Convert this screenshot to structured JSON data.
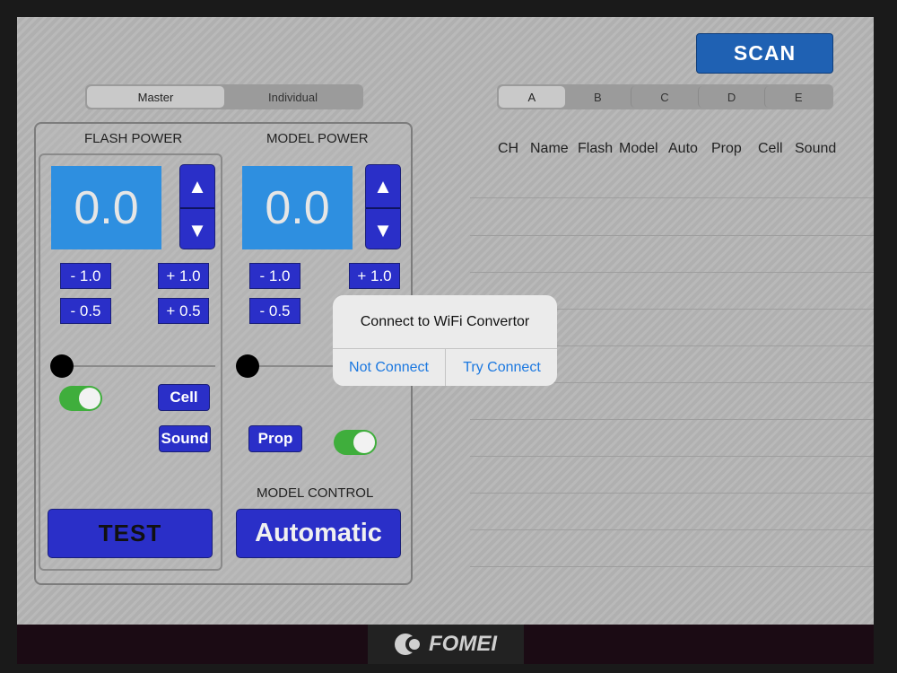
{
  "mode_tabs": [
    {
      "label": "Master",
      "selected": true
    },
    {
      "label": "Individual",
      "selected": false
    }
  ],
  "scan_label": "SCAN",
  "group_tabs": [
    {
      "label": "A",
      "selected": true
    },
    {
      "label": "B",
      "selected": false
    },
    {
      "label": "C",
      "selected": false
    },
    {
      "label": "D",
      "selected": false
    },
    {
      "label": "E",
      "selected": false
    }
  ],
  "flash": {
    "title": "FLASH POWER",
    "value": "0.0",
    "up_icon": "▲",
    "down_icon": "▼",
    "minus_1": "- 1.0",
    "plus_1": "+ 1.0",
    "minus_05": "- 0.5",
    "plus_05": "+ 0.5",
    "slider_value": 0,
    "toggle_on": true,
    "cell_label": "Cell",
    "sound_label": "Sound",
    "test_label": "TEST"
  },
  "model": {
    "title": "MODEL POWER",
    "value": "0.0",
    "up_icon": "▲",
    "down_icon": "▼",
    "minus_1": "- 1.0",
    "plus_1": "+ 1.0",
    "minus_05": "- 0.5",
    "slider_value": 0,
    "prop_label": "Prop",
    "toggle_on": true,
    "control_title": "MODEL CONTROL",
    "control_label": "Automatic"
  },
  "table": {
    "headers": [
      "CH",
      "Name",
      "Flash",
      "Model",
      "Auto",
      "Prop",
      "Cell",
      "Sound"
    ]
  },
  "dialog": {
    "title": "Connect to WiFi Convertor",
    "not_connect": "Not Connect",
    "try_connect": "Try Connect"
  },
  "footer": {
    "brand": "FOMEI"
  },
  "colors": {
    "button_blue": "#2a2fc8",
    "display_blue": "#2e8fe0",
    "scan_blue": "#1f61b3",
    "toggle_green": "#3fae3c",
    "dialog_action": "#1b78e0"
  }
}
